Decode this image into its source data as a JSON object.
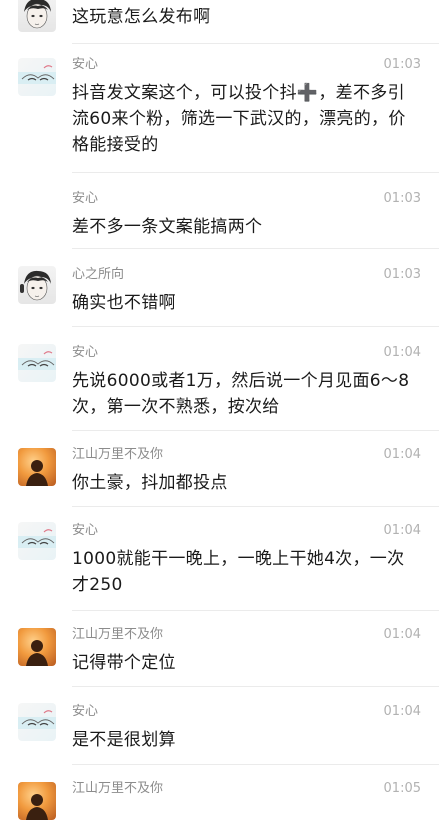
{
  "messages": [
    {
      "avatar": "boy-sketch-avatar",
      "name": "",
      "time": "",
      "text": "这玩意怎么发布啊"
    },
    {
      "avatar": "eye-sketch-avatar",
      "name": "安心",
      "time": "01:03",
      "text": "抖音发文案这个，可以投个抖➕，差不多引流60来个粉，筛选一下武汉的，漂亮的，价格能接受的"
    },
    {
      "avatar": "eye-sketch-avatar",
      "name": "安心",
      "time": "01:03",
      "text": "差不多一条文案能搞两个"
    },
    {
      "avatar": "boy-sketch-avatar",
      "name": "心之所向",
      "time": "01:03",
      "text": "确实也不错啊"
    },
    {
      "avatar": "eye-sketch-avatar",
      "name": "安心",
      "time": "01:04",
      "text": "先说6000或者1万，然后说一个月见面6～8次，第一次不熟悉，按次给"
    },
    {
      "avatar": "sunset-silhouette-avatar",
      "name": "江山万里不及你",
      "time": "01:04",
      "text": "你土豪，抖加都投点"
    },
    {
      "avatar": "eye-sketch-avatar",
      "name": "安心",
      "time": "01:04",
      "text": "1000就能干一晚上，一晚上干她4次，一次才250"
    },
    {
      "avatar": "sunset-silhouette-avatar",
      "name": "江山万里不及你",
      "time": "01:04",
      "text": "记得带个定位"
    },
    {
      "avatar": "eye-sketch-avatar",
      "name": "安心",
      "time": "01:04",
      "text": "是不是很划算"
    },
    {
      "avatar": "sunset-silhouette-avatar",
      "name": "江山万里不及你",
      "time": "01:05",
      "text": ""
    }
  ]
}
